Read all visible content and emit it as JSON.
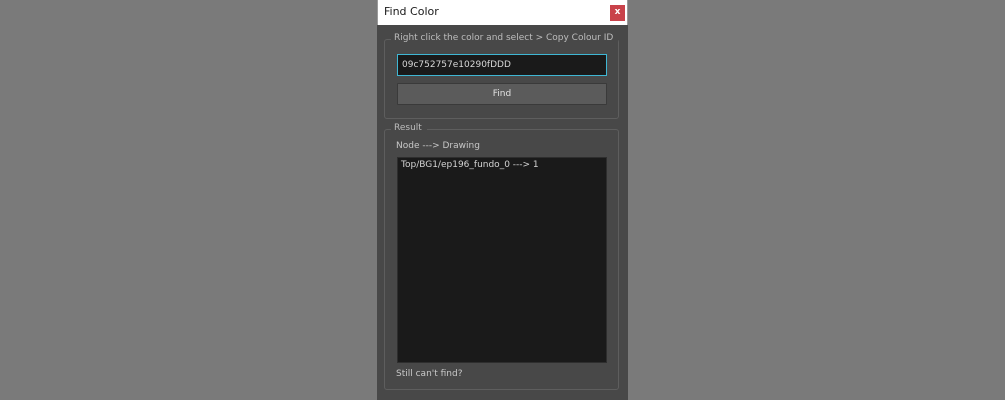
{
  "window": {
    "title": "Find Color",
    "close_label": "x"
  },
  "find_group": {
    "legend": "Right click the color and select > Copy Colour ID",
    "input_value": "09c752757e10290fDDD",
    "find_label": "Find"
  },
  "result_group": {
    "legend": "Result",
    "column_label": "Node ---> Drawing",
    "items": [
      "Top/BG1/ep196_fundo_0 ---> 1"
    ],
    "footer": "Still can't find?"
  },
  "colors": {
    "backdrop": "#7a7a7a",
    "panel": "#484848",
    "input_focus_border": "#3fb7d4",
    "close_button": "#c9424a"
  }
}
